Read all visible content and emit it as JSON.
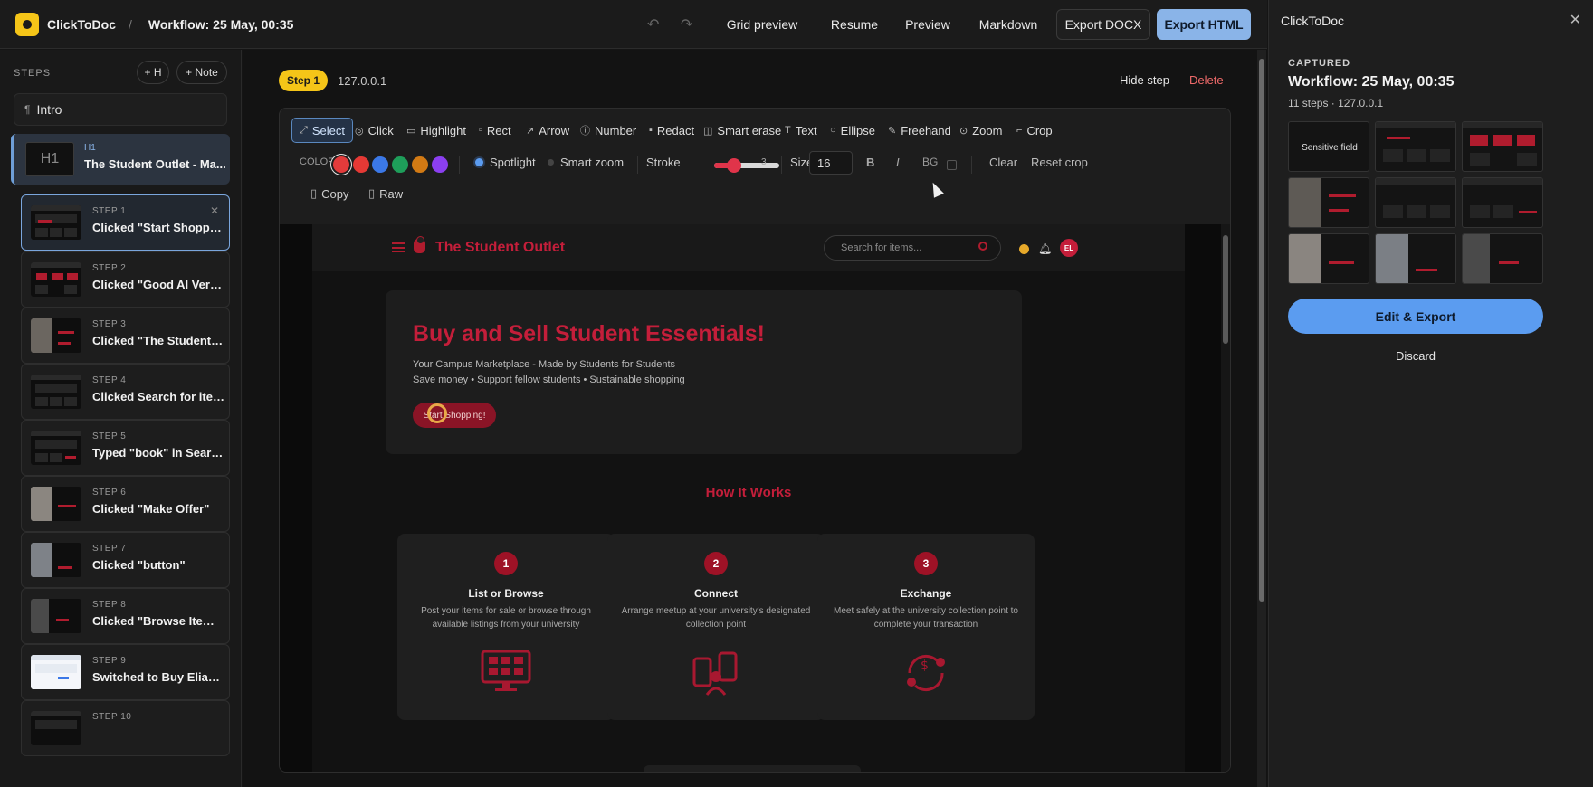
{
  "topbar": {
    "app_name": "ClickToDoc",
    "separator": "/",
    "workflow_title": "Workflow: 25 May, 00:35",
    "undo_icon": "undo-icon",
    "redo_icon": "redo-icon",
    "grid_preview": "Grid preview",
    "resume": "Resume",
    "preview": "Preview",
    "markdown": "Markdown",
    "export_docx": "Export DOCX",
    "export_html": "Export HTML"
  },
  "sidebar": {
    "steps_label": "STEPS",
    "add_heading": "+ H",
    "add_note": "+ Note",
    "intro": "Intro",
    "heading": {
      "tag": "H1",
      "thumb_label": "H1",
      "title": "The Student Outlet - Ma..."
    },
    "steps": [
      {
        "tag": "STEP 1",
        "label": "Clicked \"Start Shopping!\""
      },
      {
        "tag": "STEP 2",
        "label": "Clicked \"Good AI Verifie..."
      },
      {
        "tag": "STEP 3",
        "label": "Clicked \"The Student O..."
      },
      {
        "tag": "STEP 4",
        "label": "Clicked Search for items..."
      },
      {
        "tag": "STEP 5",
        "label": "Typed \"book\" in Search ..."
      },
      {
        "tag": "STEP 6",
        "label": "Clicked \"Make Offer\""
      },
      {
        "tag": "STEP 7",
        "label": "Clicked \"button\""
      },
      {
        "tag": "STEP 8",
        "label": "Clicked \"Browse Items\""
      },
      {
        "tag": "STEP 9",
        "label": "Switched to Buy Elias A..."
      },
      {
        "tag": "STEP 10",
        "label": ""
      }
    ]
  },
  "main": {
    "step_badge": "Step 1",
    "host": "127.0.0.1",
    "hide_step": "Hide step",
    "delete": "Delete"
  },
  "toolbar": {
    "tools": [
      "Select",
      "Click",
      "Highlight",
      "Rect",
      "Arrow",
      "Number",
      "Redact",
      "Smart erase",
      "Text",
      "Ellipse",
      "Freehand",
      "Zoom",
      "Crop"
    ],
    "active_tool": "Select",
    "color_label": "COLOR",
    "colors": [
      "#e23b3b",
      "#e53935",
      "#3b78e7",
      "#1e9e5a",
      "#d27a14",
      "#8b3ff0"
    ],
    "selected_color": "#e23b3b",
    "spotlight": "Spotlight",
    "smart_zoom": "Smart zoom",
    "stroke_label": "Stroke",
    "stroke_value": "3",
    "stroke_fraction": 0.3,
    "size_label": "Size",
    "size_value": "16",
    "bold": "B",
    "italic": "I",
    "bg_label": "BG",
    "clear": "Clear",
    "reset_crop": "Reset crop",
    "copy": "Copy",
    "raw": "Raw"
  },
  "screenshot": {
    "brand": "The Student Outlet",
    "search_placeholder": "Search for items...",
    "avatar": "EL",
    "hero_title": "Buy and Sell Student Essentials!",
    "hero_line1": "Your Campus Marketplace - Made by Students for Students",
    "hero_line2": "Save money • Support fellow students • Sustainable shopping",
    "cta": "Start Shopping!",
    "how_title": "How It Works",
    "cards": [
      {
        "num": "1",
        "title": "List or Browse",
        "desc": "Post your items for sale or browse through available listings from your university"
      },
      {
        "num": "2",
        "title": "Connect",
        "desc": "Arrange meetup at your university's designated collection point"
      },
      {
        "num": "3",
        "title": "Exchange",
        "desc": "Meet safely at the university collection point to complete your transaction"
      }
    ]
  },
  "right_panel": {
    "title": "ClickToDoc",
    "captured": "CAPTURED",
    "workflow": "Workflow: 25 May, 00:35",
    "meta": "11 steps · 127.0.0.1",
    "first_thumb_label": "Sensitive field",
    "edit_export": "Edit & Export",
    "discard": "Discard"
  },
  "colors": {
    "accent": "#f5c518",
    "primary": "#5b9cf0",
    "brand_red": "#c41e3a",
    "danger": "#f06a6a"
  }
}
